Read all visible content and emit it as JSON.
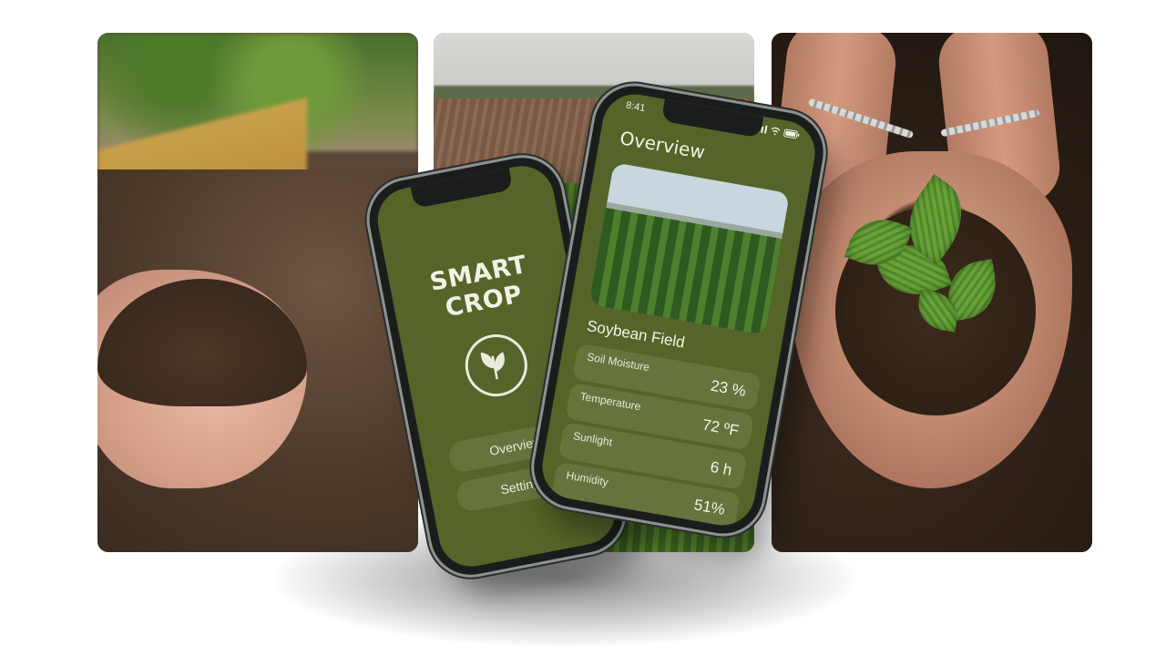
{
  "left_phone": {
    "brand": "SMART CROP",
    "menu": [
      {
        "label": "Overview"
      },
      {
        "label": "Settings"
      }
    ]
  },
  "right_phone": {
    "status_time": "8:41",
    "title": "Overview",
    "crop_name": "Soybean Field",
    "metrics": [
      {
        "label": "Soil Moisture",
        "value": "23 %"
      },
      {
        "label": "Temperature",
        "value": "72 ºF"
      },
      {
        "label": "Sunlight",
        "value": "6 h"
      },
      {
        "label": "Humidity",
        "value": "51%"
      }
    ]
  },
  "colors": {
    "app_green": "#556428",
    "text_light": "#eef0e2"
  },
  "icons": [
    "leaf-icon",
    "signal-icon",
    "wifi-icon",
    "battery-icon"
  ]
}
